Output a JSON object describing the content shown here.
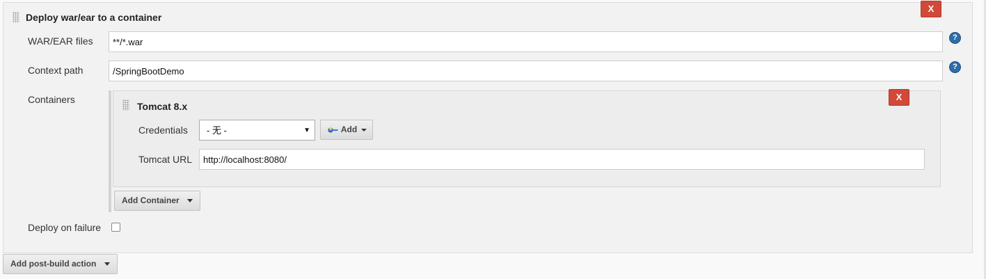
{
  "deploy_section": {
    "title": "Deploy war/ear to a container",
    "delete_label": "X",
    "war_ear_files": {
      "label": "WAR/EAR files",
      "value": "**/*.war",
      "help": "?"
    },
    "context_path": {
      "label": "Context path",
      "value": "/SpringBootDemo",
      "help": "?"
    },
    "containers": {
      "label": "Containers",
      "items": [
        {
          "title": "Tomcat 8.x",
          "delete_label": "X",
          "credentials": {
            "label": "Credentials",
            "selected": "- 无 -",
            "add_button": "Add"
          },
          "tomcat_url": {
            "label": "Tomcat URL",
            "value": "http://localhost:8080/"
          }
        }
      ],
      "add_button": "Add Container"
    },
    "deploy_on_failure": {
      "label": "Deploy on failure",
      "checked": false
    }
  },
  "add_post_build_action": {
    "label": "Add post-build action"
  },
  "colors": {
    "delete_red": "#d24939",
    "help_blue": "#2f6da8",
    "panel_bg": "#f2f2f2"
  }
}
